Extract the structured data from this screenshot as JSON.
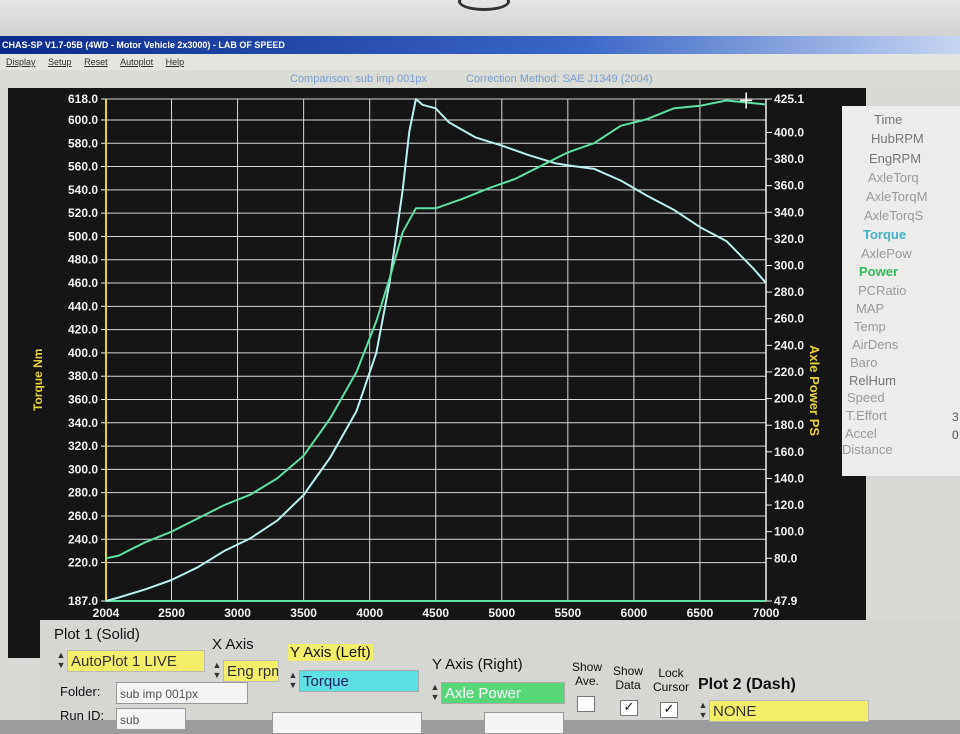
{
  "window": {
    "title": "CHAS-SP V1.7-05B  (4WD - Motor Vehicle 2x3000) - LAB OF SPEED",
    "menu": [
      "Display",
      "Setup",
      "Reset",
      "Autoplot",
      "Help"
    ]
  },
  "info": {
    "comparison": "Comparison: sub imp 001px",
    "correction": "Correction Method: SAE J1349 (2004)"
  },
  "chart_data": {
    "type": "line",
    "xlabel": "",
    "ylabel": "Torque Nm",
    "ylabel_right": "Axle Power PS",
    "x_ticks": [
      "2004",
      "2500",
      "3000",
      "3500",
      "4000",
      "4500",
      "5000",
      "5500",
      "6000",
      "6500",
      "7000"
    ],
    "y_left_ticks": [
      "618.0",
      "600.0",
      "580.0",
      "560.0",
      "540.0",
      "520.0",
      "500.0",
      "480.0",
      "460.0",
      "440.0",
      "420.0",
      "400.0",
      "380.0",
      "360.0",
      "340.0",
      "320.0",
      "300.0",
      "280.0",
      "260.0",
      "240.0",
      "220.0",
      "187.0"
    ],
    "y_right_ticks": [
      "425.1",
      "400.0",
      "380.0",
      "360.0",
      "340.0",
      "320.0",
      "300.0",
      "280.0",
      "260.0",
      "240.0",
      "220.0",
      "200.0",
      "180.0",
      "160.0",
      "140.0",
      "120.0",
      "100.0",
      "80.0",
      "47.9"
    ],
    "xlim": [
      2004,
      7000
    ],
    "ylim_left": [
      187.0,
      618.0
    ],
    "ylim_right": [
      47.9,
      425.1
    ],
    "grid": true,
    "series": [
      {
        "name": "Torque",
        "axis": "left",
        "color": "#b8f0f0",
        "x": [
          2004,
          2100,
          2300,
          2500,
          2700,
          2900,
          3100,
          3300,
          3500,
          3700,
          3900,
          4050,
          4150,
          4250,
          4300,
          4350,
          4400,
          4500,
          4600,
          4800,
          5000,
          5200,
          5400,
          5500,
          5700,
          5900,
          6100,
          6300,
          6500,
          6700,
          6900,
          7000
        ],
        "y": [
          187,
          190,
          197,
          205,
          216,
          230,
          241,
          256,
          278,
          310,
          350,
          400,
          460,
          540,
          590,
          618,
          613,
          610,
          598,
          585,
          578,
          570,
          563,
          561,
          558,
          548,
          535,
          523,
          508,
          496,
          473,
          460
        ]
      },
      {
        "name": "Power",
        "axis": "right",
        "color": "#5fe0a0",
        "x": [
          2004,
          2100,
          2300,
          2500,
          2700,
          2900,
          3100,
          3300,
          3500,
          3700,
          3900,
          4050,
          4150,
          4250,
          4350,
          4500,
          4700,
          4900,
          5100,
          5300,
          5500,
          5700,
          5900,
          6100,
          6300,
          6500,
          6700,
          6900,
          7000
        ],
        "y": [
          80,
          82,
          92,
          100,
          110,
          120,
          128,
          140,
          157,
          185,
          220,
          258,
          290,
          325,
          343,
          343,
          350,
          358,
          365,
          375,
          385,
          392,
          405,
          410,
          418,
          420,
          424,
          422,
          421
        ]
      }
    ],
    "cursor_x": 6850
  },
  "params": {
    "items": [
      "Time",
      "HubRPM",
      "EngRPM",
      "AxleTorq",
      "AxleTorqM",
      "AxleTorqS",
      "Torque",
      "AxlePow",
      "Power",
      "PCRatio",
      "MAP",
      "Temp",
      "AirDens",
      "Baro",
      "RelHum",
      "Speed",
      "T.Effort",
      "Accel",
      "Distance"
    ],
    "side_values": [
      "3",
      "0"
    ]
  },
  "controls": {
    "plot1_label": "Plot 1 (Solid)",
    "plot1_value": "AutoPlot 1 LIVE",
    "xaxis_label": "X Axis",
    "xaxis_value": "Eng rpm",
    "yleft_label": "Y Axis (Left)",
    "yleft_value": "Torque",
    "yright_label": "Y Axis (Right)",
    "yright_value": "Axle Power",
    "show_ave": "Show Ave.",
    "show_data": "Show Data",
    "lock_cursor": "Lock Cursor",
    "plot2_label": "Plot 2 (Dash)",
    "plot2_value": "NONE",
    "folder_label": "Folder:",
    "folder_value": "sub imp 001px",
    "runid_label": "Run ID:",
    "runid_value": "sub"
  }
}
